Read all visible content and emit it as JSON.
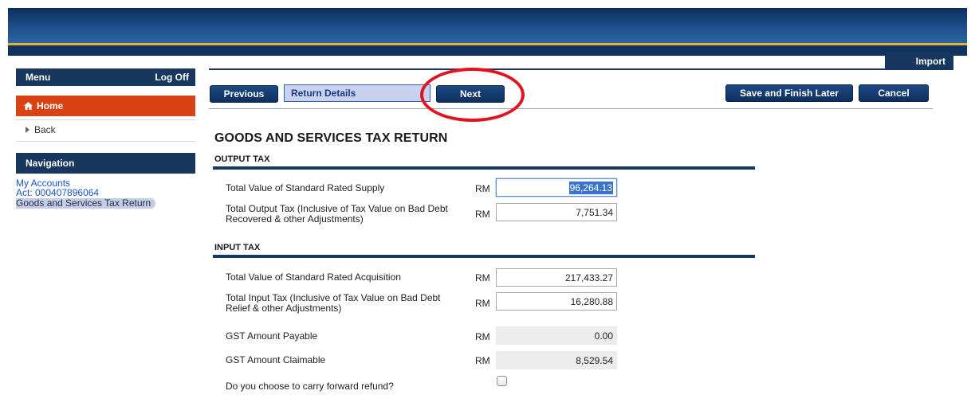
{
  "header": {
    "import_label": "Import"
  },
  "sidebar": {
    "menu_label": "Menu",
    "logoff_label": "Log Off",
    "home_label": "Home",
    "back_label": "Back",
    "navigation_label": "Navigation",
    "links": {
      "my_accounts": "My Accounts",
      "account": "Act: 000407896064",
      "current": "Goods and Services Tax Return"
    }
  },
  "toolbar": {
    "previous_label": "Previous",
    "return_details_label": "Return Details",
    "next_label": "Next",
    "save_label": "Save and Finish Later",
    "cancel_label": "Cancel"
  },
  "form": {
    "title": "GOODS AND SERVICES TAX RETURN",
    "output_section": "OUTPUT TAX",
    "input_section": "INPUT TAX",
    "currency": "RM",
    "rows": [
      {
        "label": "Total Value of Standard Rated Supply",
        "value": "96,264.13"
      },
      {
        "label": "Total Output Tax (Inclusive of Tax Value on Bad Debt Recovered & other Adjustments)",
        "value": "7,751.34"
      },
      {
        "label": "Total Value of Standard Rated Acquisition",
        "value": "217,433.27"
      },
      {
        "label": "Total Input Tax (Inclusive of Tax Value on Bad Debt Relief & other Adjustments)",
        "value": "16,280.88"
      },
      {
        "label": "GST Amount Payable",
        "value": "0.00"
      },
      {
        "label": "GST Amount Claimable",
        "value": "8,529.54"
      }
    ],
    "carry_forward_label": "Do you choose to carry forward refund?",
    "carry_forward_checked": false
  },
  "colors": {
    "navy": "#17375e",
    "home_orange": "#d84315",
    "annotation_red": "#e2121e",
    "banner_gold": "#e0b43a",
    "link_blue": "#1a55c8"
  }
}
